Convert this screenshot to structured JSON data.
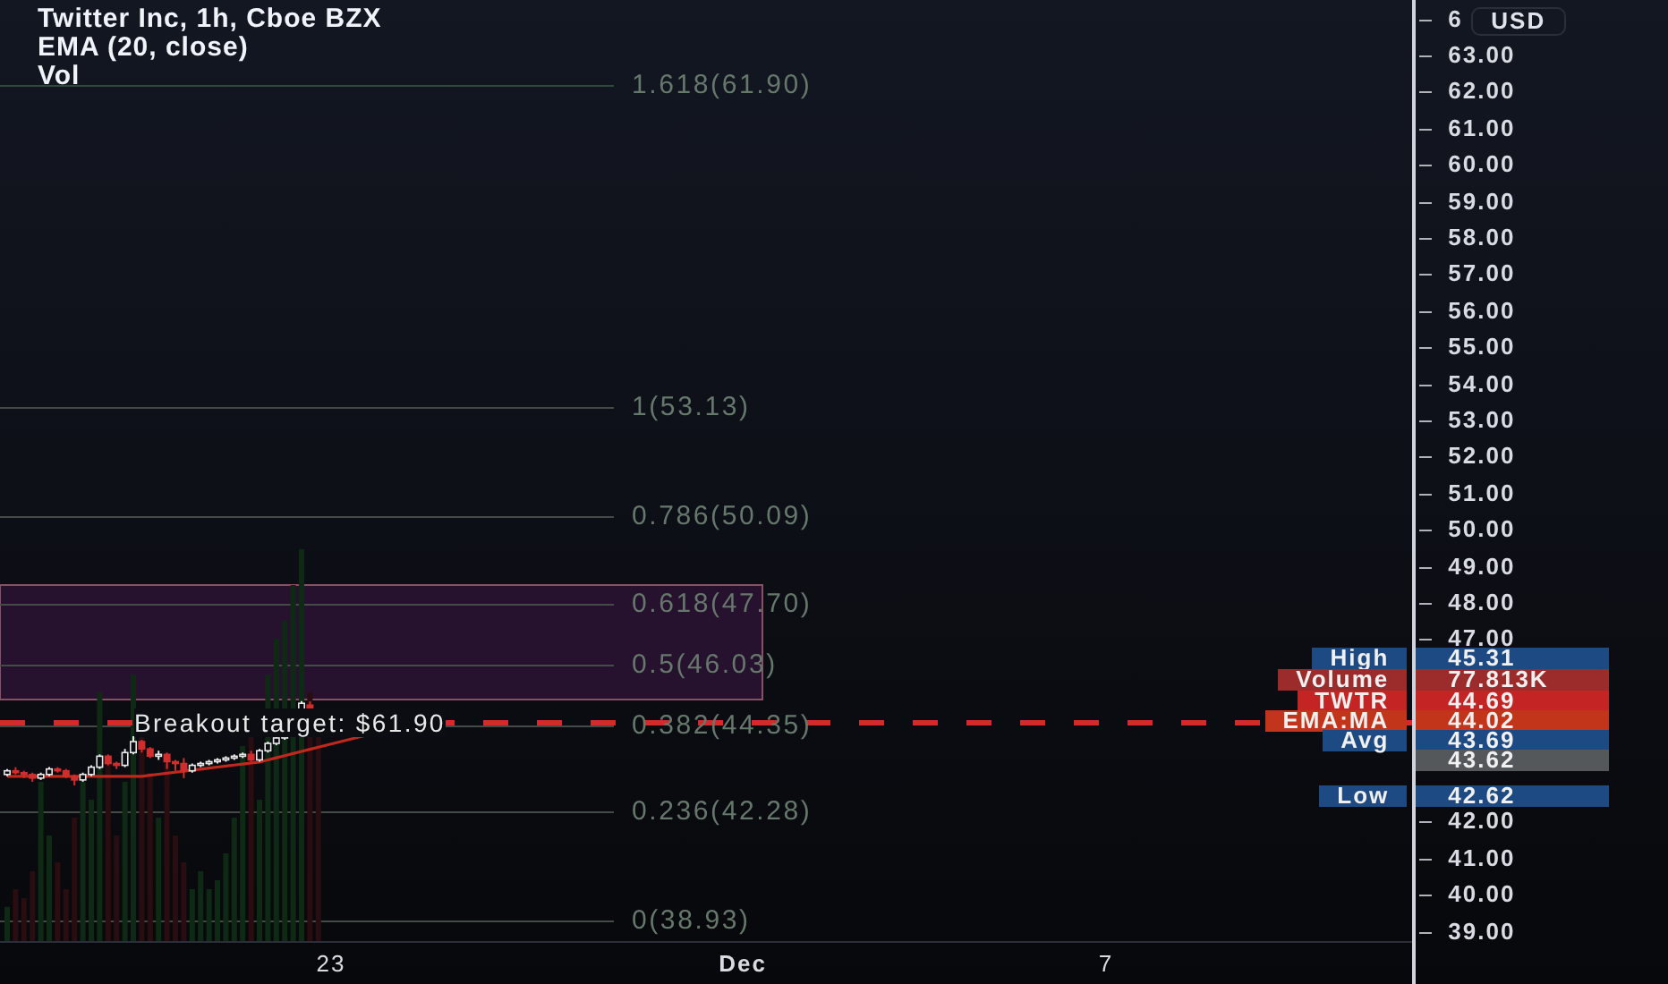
{
  "legend": [
    "Twitter Inc, 1h, Cboe BZX",
    "EMA (20, close)",
    "Vol"
  ],
  "currency": "USD",
  "fib_levels": [
    {
      "label": "1.618(61.90)"
    },
    {
      "label": "1(53.13)"
    },
    {
      "label": "0.786(50.09)"
    },
    {
      "label": "0.618(47.70)"
    },
    {
      "label": "0.5(46.03)"
    },
    {
      "label": "0.382(44.35)"
    },
    {
      "label": "0.236(42.28)"
    },
    {
      "label": "0(38.93)"
    }
  ],
  "breakout_label": "Breakout target: $61.90",
  "price_ticks": [
    "6",
    "63.00",
    "62.00",
    "61.00",
    "60.00",
    "59.00",
    "58.00",
    "57.00",
    "56.00",
    "55.00",
    "54.00",
    "53.00",
    "52.00",
    "51.00",
    "50.00",
    "49.00",
    "48.00",
    "47.00",
    "42.00",
    "41.00",
    "40.00",
    "39.00"
  ],
  "price_tags": [
    {
      "label": "High",
      "value": "45.31",
      "color": "#1d4a82"
    },
    {
      "label": "Volume",
      "value": "77.813K",
      "color": "#9c2b2b"
    },
    {
      "label": "TWTR",
      "value": "44.69",
      "color": "#c42424"
    },
    {
      "label": "EMA:MA",
      "value": "44.02",
      "color": "#c2351a"
    },
    {
      "label": "Avg",
      "value": "43.69",
      "color": "#1d4a82"
    },
    {
      "value": "43.62",
      "color": "#55585b"
    },
    {
      "label": "Low",
      "value": "42.62",
      "color": "#1d4a82"
    }
  ],
  "time_ticks": [
    {
      "label": "23",
      "bold": false
    },
    {
      "label": "Dec",
      "bold": true
    },
    {
      "label": "7",
      "bold": false
    }
  ]
}
